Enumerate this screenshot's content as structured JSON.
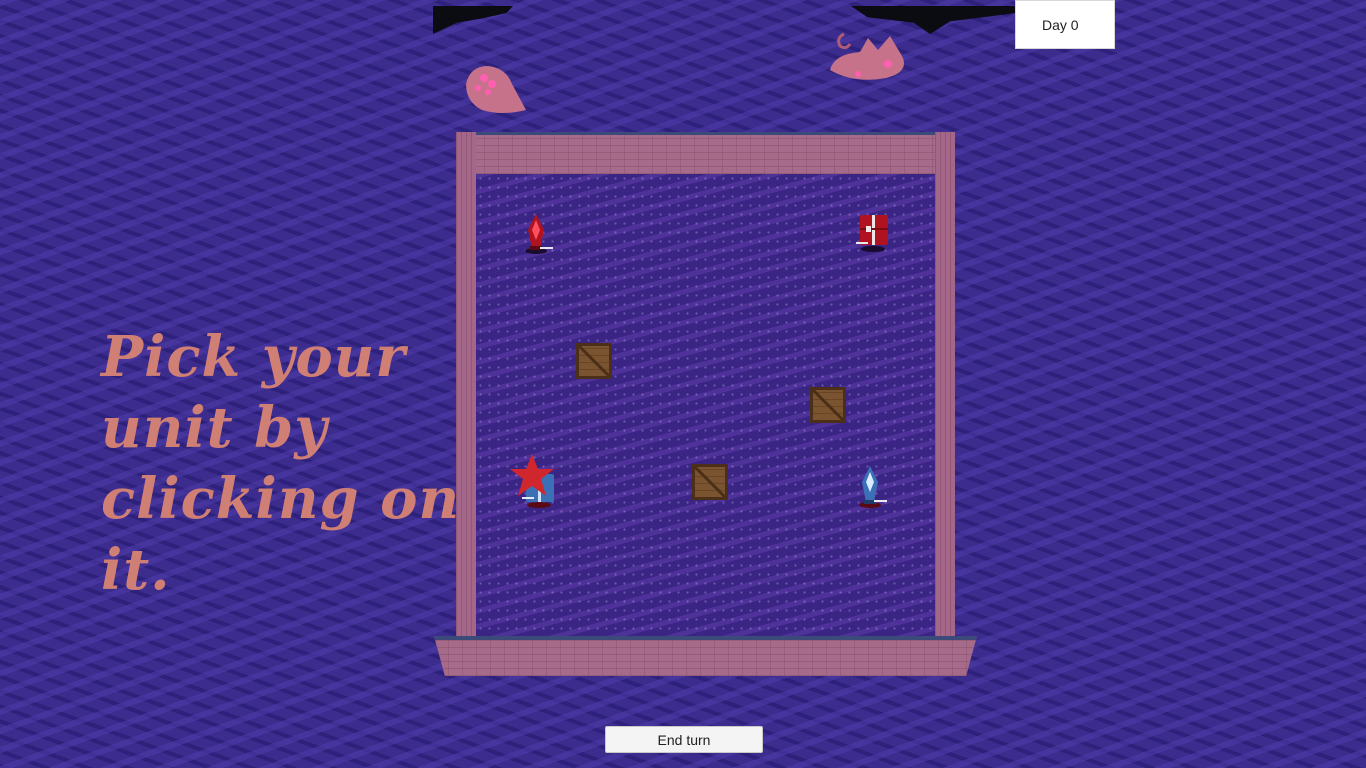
{
  "hud": {
    "day_label": "Day 0",
    "end_turn_label": "End turn"
  },
  "instruction": {
    "text": "Pick your unit by clicking on it."
  },
  "colors": {
    "background": "#3b2c8e",
    "wall": "#a66a8a",
    "instruction_text": "#d07f74",
    "red_team": "#c1121f",
    "blue_team": "#3b6fb6",
    "selection_star": "#d0262d"
  },
  "units": [
    {
      "team": "red",
      "type": "lancer",
      "icon": "red-lancer-icon"
    },
    {
      "team": "red",
      "type": "shield",
      "icon": "red-shield-icon"
    },
    {
      "team": "blue",
      "type": "shield",
      "icon": "blue-shield-icon",
      "selected": true
    },
    {
      "team": "blue",
      "type": "lancer",
      "icon": "blue-lancer-icon"
    }
  ],
  "obstacles": [
    "crate",
    "crate",
    "crate"
  ]
}
